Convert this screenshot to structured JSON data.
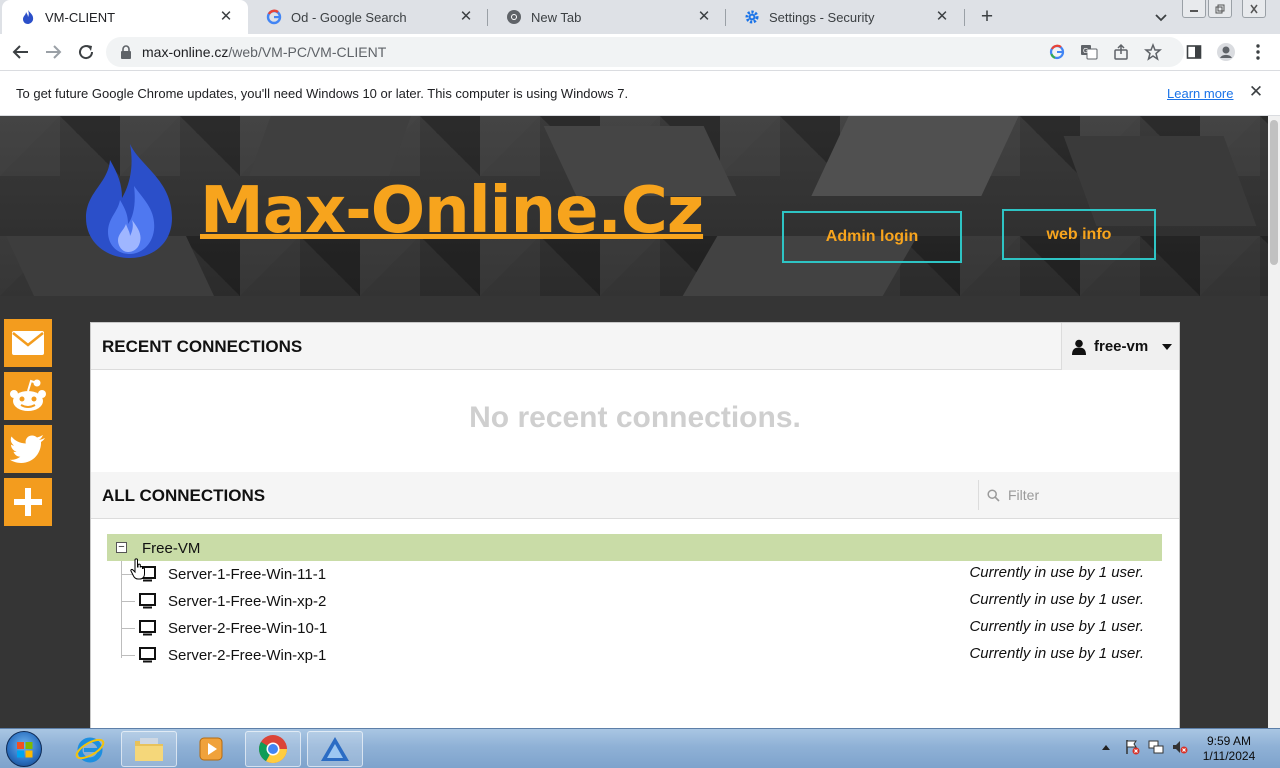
{
  "tabs": [
    {
      "title": "VM-CLIENT",
      "icon": "flame-logo-icon",
      "active": true
    },
    {
      "title": "Od - Google Search",
      "icon": "google-g-icon",
      "active": false
    },
    {
      "title": "New Tab",
      "icon": "chrome-icon",
      "active": false
    },
    {
      "title": "Settings - Security",
      "icon": "gear-icon",
      "active": false
    }
  ],
  "tab_close_glyph": "✕",
  "newtab_glyph": "+",
  "address": {
    "domain": "max-online.cz",
    "path": "/web/VM-PC/VM-CLIENT"
  },
  "infobar": {
    "message": "To get future Google Chrome updates, you'll need Windows 10 or later. This computer is using Windows 7.",
    "link": "Learn more",
    "close_glyph": "✕"
  },
  "banner": {
    "brand": "Max-Online.Cz",
    "admin_button": "Admin login",
    "info_button": "web info"
  },
  "social": [
    "mail-icon",
    "reddit-icon",
    "twitter-icon",
    "plus-icon"
  ],
  "recent": {
    "title": "RECENT CONNECTIONS",
    "empty": "No recent connections."
  },
  "user": {
    "name": "free-vm"
  },
  "all": {
    "title": "ALL CONNECTIONS",
    "filter_placeholder": "Filter"
  },
  "group": {
    "name": "Free-VM",
    "toggle": "−"
  },
  "connections": [
    {
      "name": "Server-1-Free-Win-11-1",
      "status": "Currently in use by 1 user."
    },
    {
      "name": "Server-1-Free-Win-xp-2",
      "status": "Currently in use by 1 user."
    },
    {
      "name": "Server-2-Free-Win-10-1",
      "status": "Currently in use by 1 user."
    },
    {
      "name": "Server-2-Free-Win-xp-1",
      "status": "Currently in use by 1 user."
    }
  ],
  "taskbar": {
    "items": [
      "internet-explorer-icon",
      "file-explorer-icon",
      "media-player-icon",
      "chrome-icon",
      "remote-app-icon"
    ],
    "time": "9:59 AM",
    "date": "1/11/2024"
  },
  "colors": {
    "accent_orange": "#f7a41d",
    "teal_border": "#2ec4c4",
    "group_green": "#c9dca7",
    "social_orange": "#f39c1e"
  }
}
